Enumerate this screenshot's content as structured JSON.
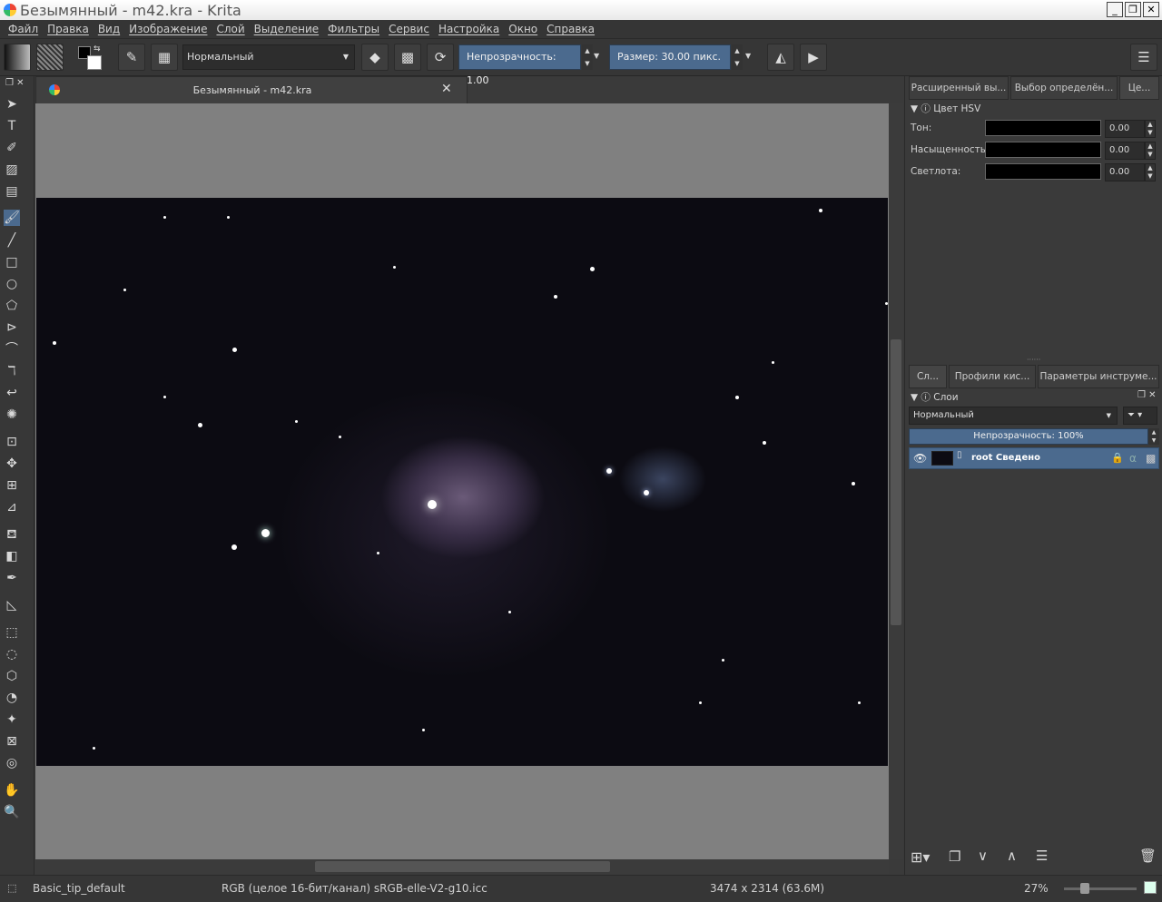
{
  "window": {
    "title": "Безымянный - m42.kra  - Krita",
    "minimize_icon": "minimize-icon",
    "maximize_icon": "restore-icon",
    "close_icon": "close-icon"
  },
  "menu": [
    "Файл",
    "Правка",
    "Вид",
    "Изображение",
    "Слой",
    "Выделение",
    "Фильтры",
    "Сервис",
    "Настройка",
    "Окно",
    "Справка"
  ],
  "toolbar": {
    "blend_mode": "Нормальный",
    "opacity_label": "Непрозрачность:",
    "opacity_value": "1.00",
    "size_label": "Размер:",
    "size_value": "30.00 пикс."
  },
  "document": {
    "tab_title": "Безымянный - m42.kra"
  },
  "dock": {
    "top_tabs": [
      "Расширенный вы...",
      "Выбор определён...",
      "Це..."
    ],
    "hsv_panel_title": "Цвет HSV",
    "hsv": [
      {
        "label": "Тон:",
        "value": "0.00"
      },
      {
        "label": "Насыщенность:",
        "value": "0.00"
      },
      {
        "label": "Светлота:",
        "value": "0.00"
      }
    ],
    "bottom_tabs": [
      "Сл...",
      "Профили кис...",
      "Параметры инструме..."
    ],
    "layers_title": "Слои",
    "layers_blend_mode": "Нормальный",
    "layers_opacity": "Непрозрачность:  100%",
    "layers": [
      {
        "name": "root Сведено",
        "visible": true
      }
    ]
  },
  "status": {
    "brush": "Basic_tip_default",
    "color_profile": "RGB (целое 16-бит/канал)  sRGB-elle-V2-g10.icc",
    "dimensions": "3474 x 2314 (63.6M)",
    "zoom": "27%"
  },
  "colors": {
    "accent": "#4b6a8e",
    "panel_bg": "#3a3a3a",
    "canvas_bg": "#808080"
  }
}
